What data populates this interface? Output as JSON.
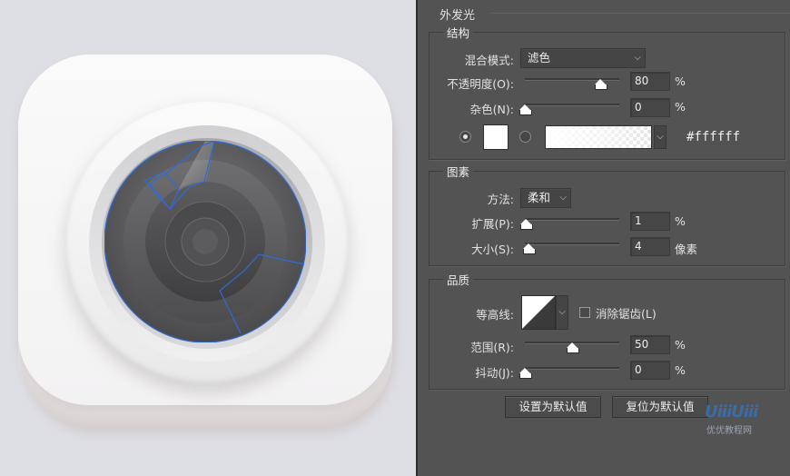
{
  "canvas": {
    "bg": "#dedfe5",
    "icon_color": "#f5f4f5",
    "lens_color": "#5a5a5c",
    "path_color": "#2f6bd6"
  },
  "panel": {
    "bg": "#535353",
    "title": "外发光",
    "structure": {
      "legend": "结构",
      "blend_mode_label": "混合模式:",
      "blend_mode_value": "滤色",
      "opacity_label": "不透明度(O):",
      "opacity_value": "80",
      "opacity_unit": "%",
      "opacity_level": 80,
      "noise_label": "杂色(N):",
      "noise_value": "0",
      "noise_unit": "%",
      "noise_level": 0,
      "color_hex": "#ffffff",
      "color_swatch": "#ffffff"
    },
    "elements": {
      "legend": "图素",
      "technique_label": "方法:",
      "technique_value": "柔和",
      "spread_label": "扩展(P):",
      "spread_value": "1",
      "spread_unit": "%",
      "spread_level": 1,
      "size_label": "大小(S):",
      "size_value": "4",
      "size_unit": "像素",
      "size_level": 4
    },
    "quality": {
      "legend": "品质",
      "contour_label": "等高线:",
      "anti_alias_label": "消除锯齿(L)",
      "anti_alias_checked": false,
      "range_label": "范围(R):",
      "range_value": "50",
      "range_unit": "%",
      "range_level": 50,
      "jitter_label": "抖动(J):",
      "jitter_value": "0",
      "jitter_unit": "%",
      "jitter_level": 0
    },
    "buttons": {
      "make_default": "设置为默认值",
      "reset_default": "复位为默认值"
    },
    "watermark": {
      "logo": "UiiiUiii",
      "text": "优优教程网"
    }
  }
}
